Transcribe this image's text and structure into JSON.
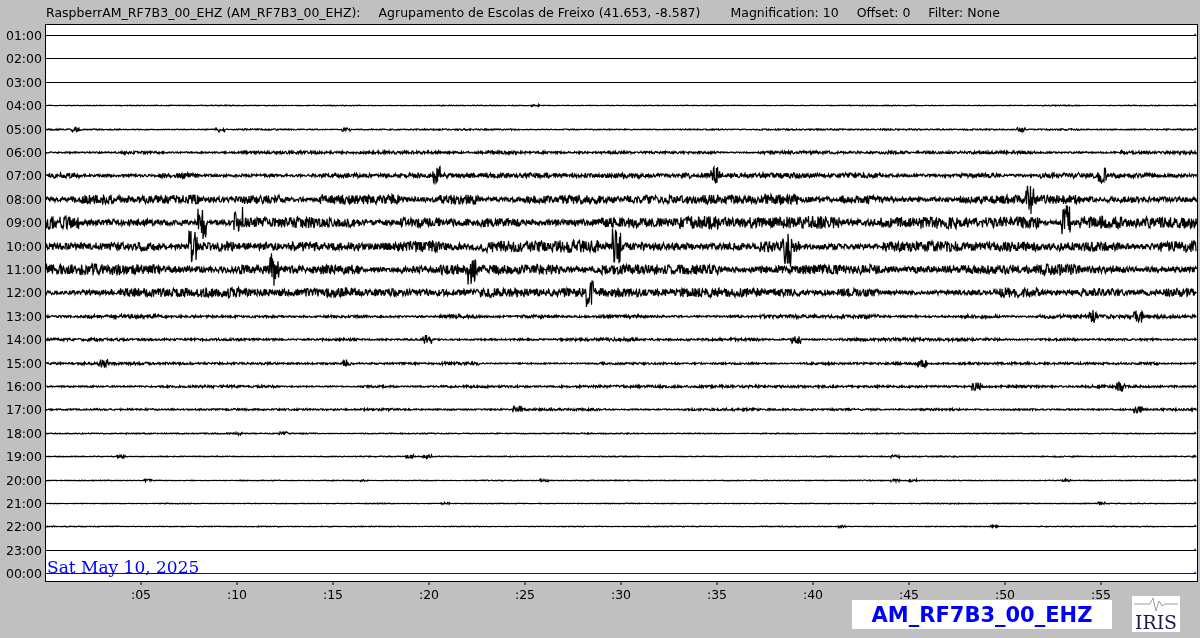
{
  "header": {
    "station": "RaspberrAM_RF7B3_00_EHZ (AM_RF7B3_00_EHZ):",
    "location": "Agrupamento de Escolas de Freixo (41.653, -8.587)",
    "magnification": "Magnification: 10",
    "offset": "Offset: 0",
    "filter": "Filter: None"
  },
  "rows": [
    {
      "label": "01:00",
      "color": "#000000"
    },
    {
      "label": "02:00",
      "color": "#000000"
    },
    {
      "label": "03:00",
      "color": "#000000"
    },
    {
      "label": "04:00",
      "color": "#000000"
    },
    {
      "label": "05:00",
      "color": "#000000"
    },
    {
      "label": "06:00",
      "color": "#000000"
    },
    {
      "label": "07:00",
      "color": "#000000"
    },
    {
      "label": "08:00",
      "color": "#000000"
    },
    {
      "label": "09:00",
      "color": "#000000"
    },
    {
      "label": "10:00",
      "color": "#000000"
    },
    {
      "label": "11:00",
      "color": "#000000"
    },
    {
      "label": "12:00",
      "color": "#000000"
    },
    {
      "label": "13:00",
      "color": "#000000"
    },
    {
      "label": "14:00",
      "color": "#000000"
    },
    {
      "label": "15:00",
      "color": "#000000"
    },
    {
      "label": "16:00",
      "color": "#000000"
    },
    {
      "label": "17:00",
      "color": "#000000"
    },
    {
      "label": "18:00",
      "color": "#000000"
    },
    {
      "label": "19:00",
      "color": "#000000"
    },
    {
      "label": "20:00",
      "color": "#000000"
    },
    {
      "label": "21:00",
      "color": "#000000"
    },
    {
      "label": "22:00",
      "color": "#000000"
    },
    {
      "label": "23:00",
      "color": "#000000"
    },
    {
      "label": "00:00",
      "color": "#0000ff"
    }
  ],
  "date": "Sat May 10, 2025",
  "x_ticks": [
    ":05",
    ":10",
    ":15",
    ":20",
    ":25",
    ":30",
    ":35",
    ":40",
    ":45",
    ":50",
    ":55"
  ],
  "station_label": "AM_RF7B3_00_EHZ",
  "logo": "IRIS"
}
